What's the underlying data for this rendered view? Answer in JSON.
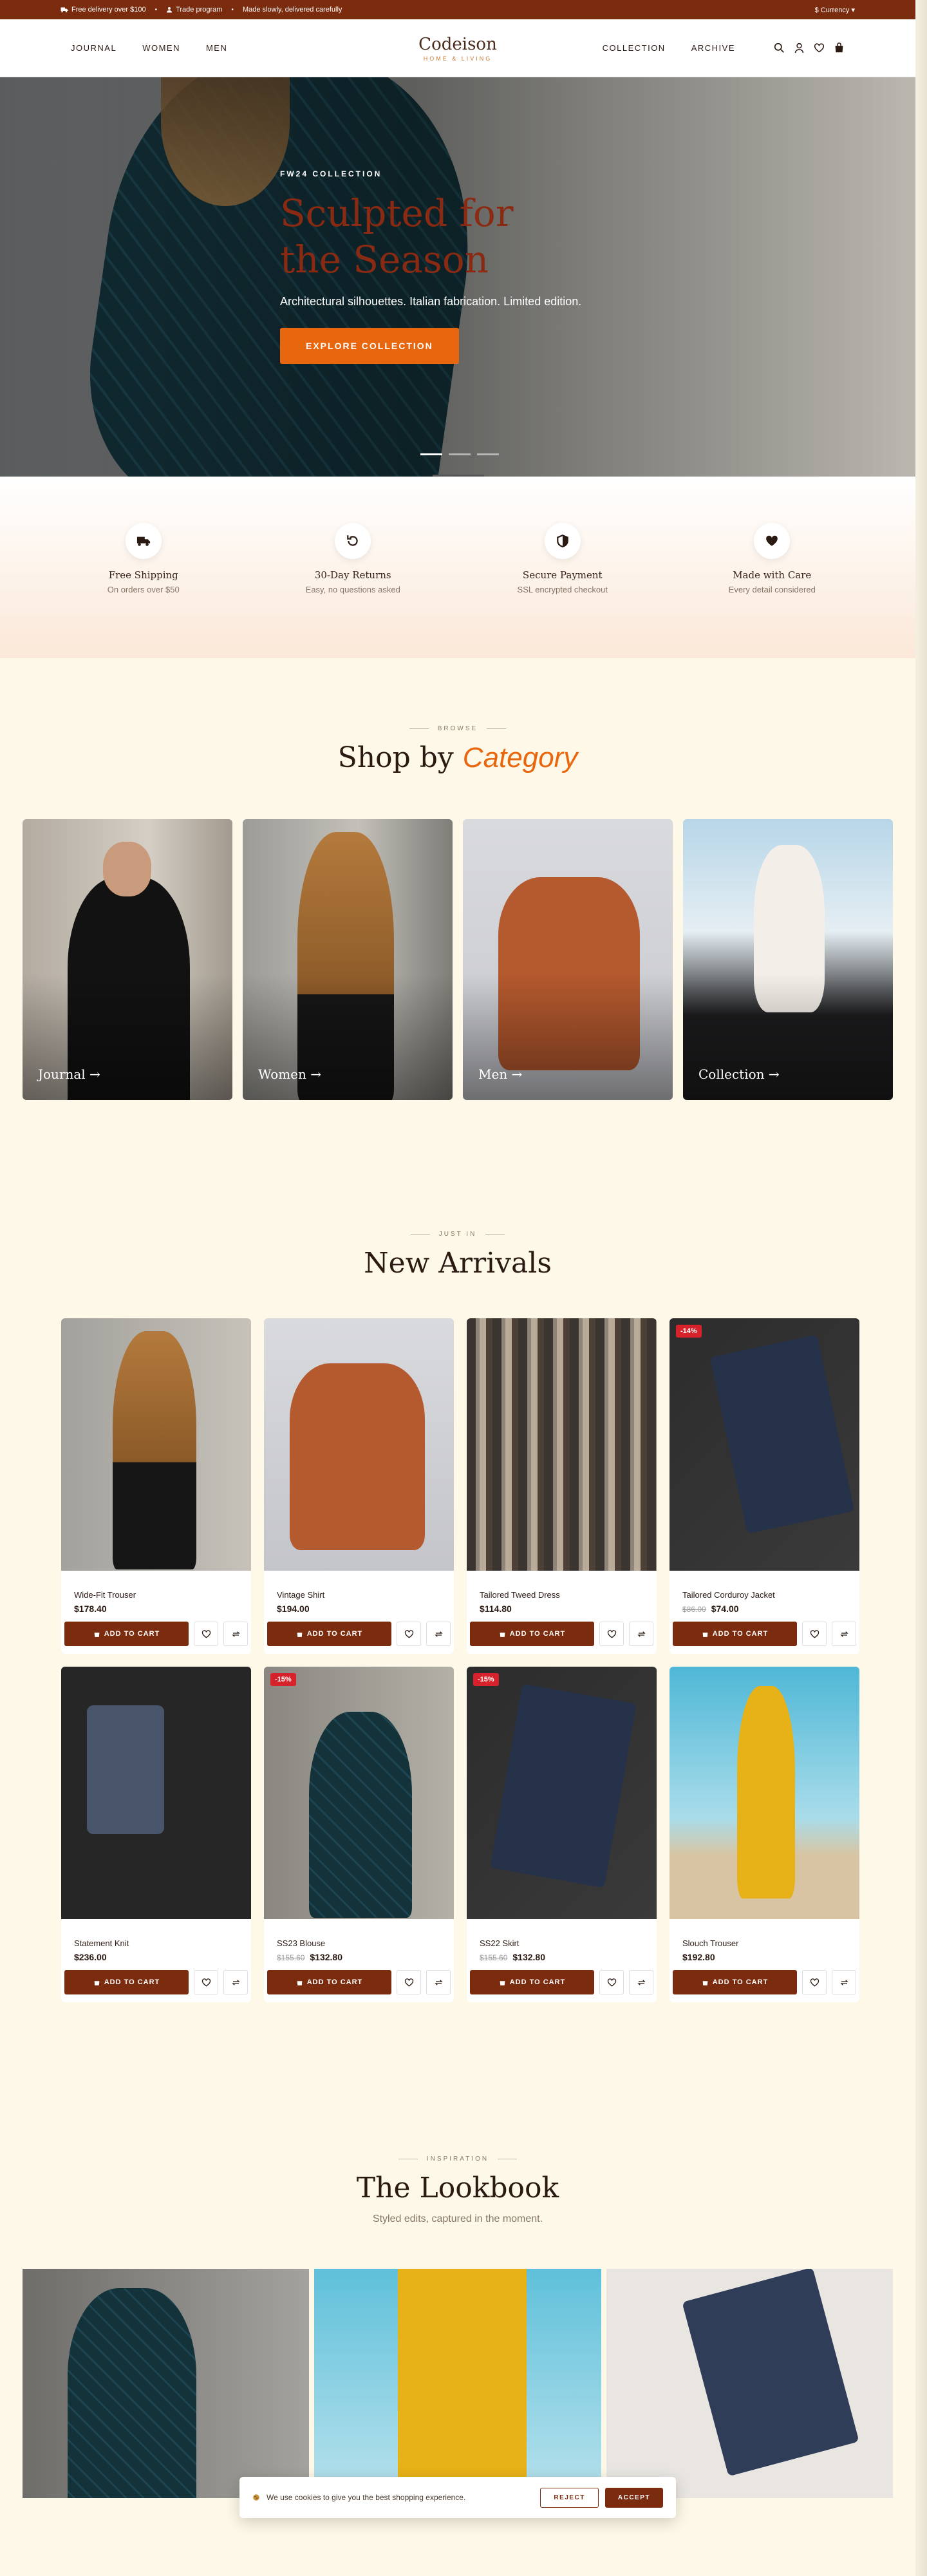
{
  "topbar": {
    "free_delivery": "Free delivery over $100",
    "trade": "Trade program",
    "tagline": "Made slowly, delivered carefully",
    "currency": "$ Currency ▾"
  },
  "nav": {
    "left": [
      "JOURNAL",
      "WOMEN",
      "MEN"
    ],
    "right": [
      "COLLECTION",
      "ARCHIVE"
    ]
  },
  "logo": {
    "name": "Codeison",
    "sub": "HOME & LIVING"
  },
  "hero": {
    "kicker": "FW24 COLLECTION",
    "title": "Sculpted for the Season",
    "desc": "Architectural silhouettes. Italian fabrication. Limited edition.",
    "cta": "EXPLORE COLLECTION"
  },
  "features": [
    {
      "title": "Free Shipping",
      "sub": "On orders over $50",
      "icon": "truck-icon"
    },
    {
      "title": "30-Day Returns",
      "sub": "Easy, no questions asked",
      "icon": "return-icon"
    },
    {
      "title": "Secure Payment",
      "sub": "SSL encrypted checkout",
      "icon": "shield-icon"
    },
    {
      "title": "Made with Care",
      "sub": "Every detail considered",
      "icon": "heart-icon"
    }
  ],
  "category": {
    "kicker": "BROWSE",
    "title_a": "Shop by",
    "title_b": "Category",
    "items": [
      "Journal →",
      "Women →",
      "Men →",
      "Collection →"
    ]
  },
  "arrivals": {
    "kicker": "JUST IN",
    "title": "New Arrivals",
    "add_label": "ADD TO CART",
    "products": [
      {
        "name": "Wide-Fit Trouser",
        "price": "$178.40",
        "old": "",
        "badge": ""
      },
      {
        "name": "Vintage Shirt",
        "price": "$194.00",
        "old": "",
        "badge": ""
      },
      {
        "name": "Tailored Tweed Dress",
        "price": "$114.80",
        "old": "",
        "badge": ""
      },
      {
        "name": "Tailored Corduroy Jacket",
        "price": "$74.00",
        "old": "$86.00",
        "badge": "-14%"
      },
      {
        "name": "Statement Knit",
        "price": "$236.00",
        "old": "",
        "badge": ""
      },
      {
        "name": "SS23 Blouse",
        "price": "$132.80",
        "old": "$155.60",
        "badge": "-15%"
      },
      {
        "name": "SS22 Skirt",
        "price": "$132.80",
        "old": "$155.60",
        "badge": "-15%"
      },
      {
        "name": "Slouch Trouser",
        "price": "$192.80",
        "old": "",
        "badge": ""
      }
    ]
  },
  "lookbook": {
    "kicker": "INSPIRATION",
    "title": "The Lookbook",
    "sub": "Styled edits, captured in the moment."
  },
  "cookie": {
    "text": "We use cookies to give you the best shopping experience.",
    "reject": "REJECT",
    "accept": "ACCEPT"
  },
  "colors": {
    "brand": "#7b2c0f",
    "accent": "#e8660e",
    "badge": "#d8222b",
    "bg": "#fdf8e7"
  }
}
